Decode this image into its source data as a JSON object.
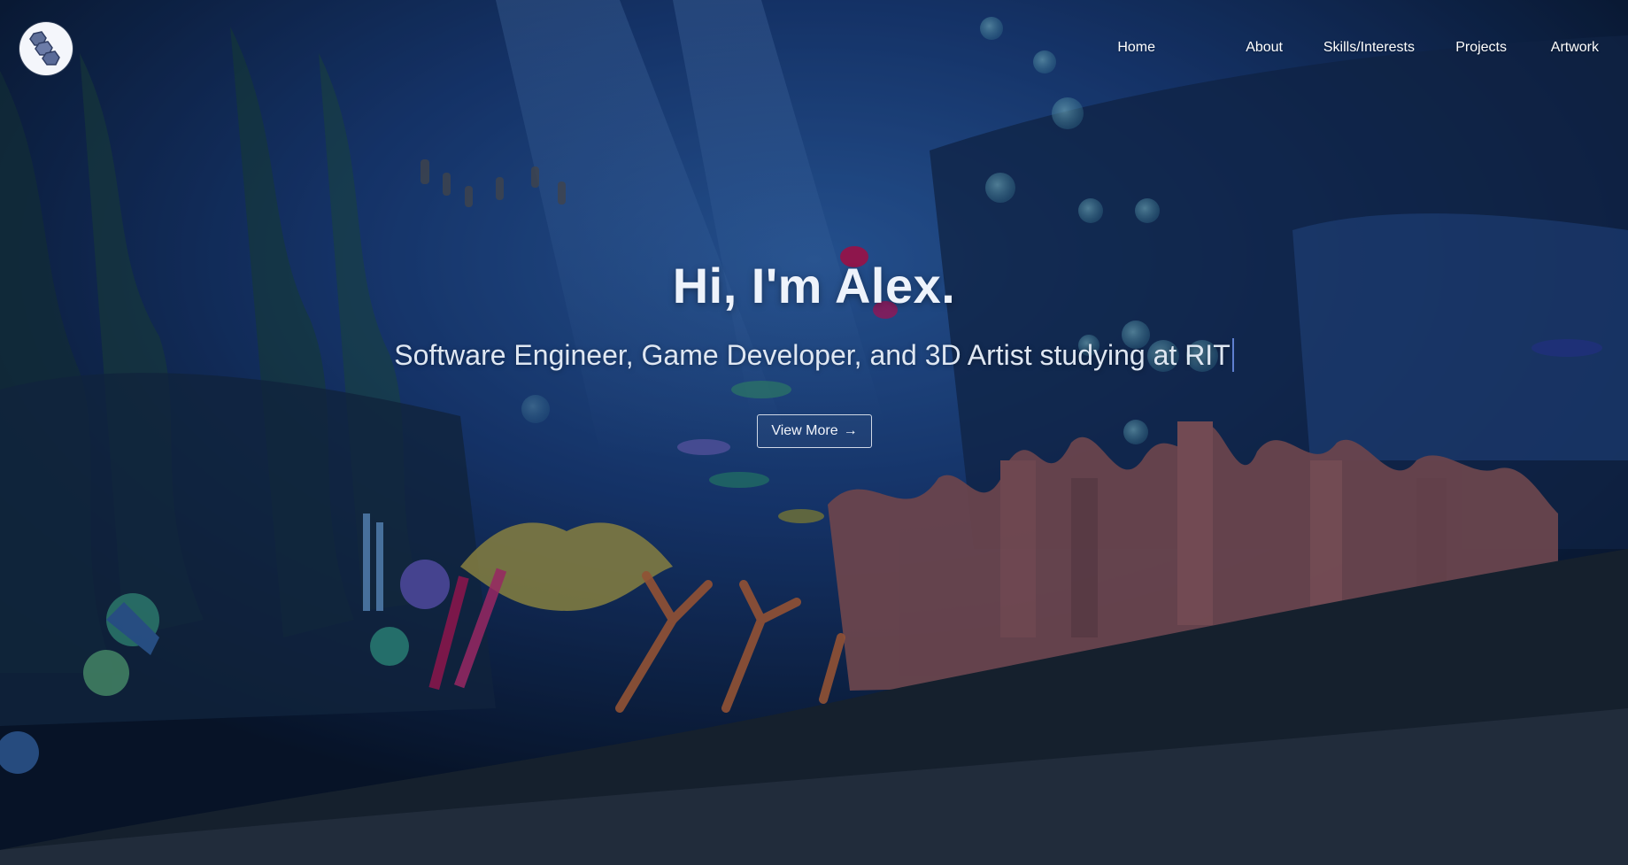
{
  "logo": {
    "icon": "hexagon-chain-logo-icon"
  },
  "nav": {
    "items": [
      {
        "label": "Home"
      },
      {
        "label": "About"
      },
      {
        "label": "Skills/Interests"
      },
      {
        "label": "Projects"
      },
      {
        "label": "Artwork"
      }
    ]
  },
  "hero": {
    "title": "Hi, I'm Alex.",
    "subtitle": "Software Engineer, Game Developer, and 3D Artist studying at RIT",
    "button_label": "View More",
    "button_arrow": "→"
  },
  "colors": {
    "deep_water": "#0a1a3a",
    "mid_water": "#1d4a8f",
    "bottom_wave": "#1b2630",
    "footer": "#2c3643",
    "coral": "#9a5a5e",
    "caret": "#5f7fd0"
  }
}
